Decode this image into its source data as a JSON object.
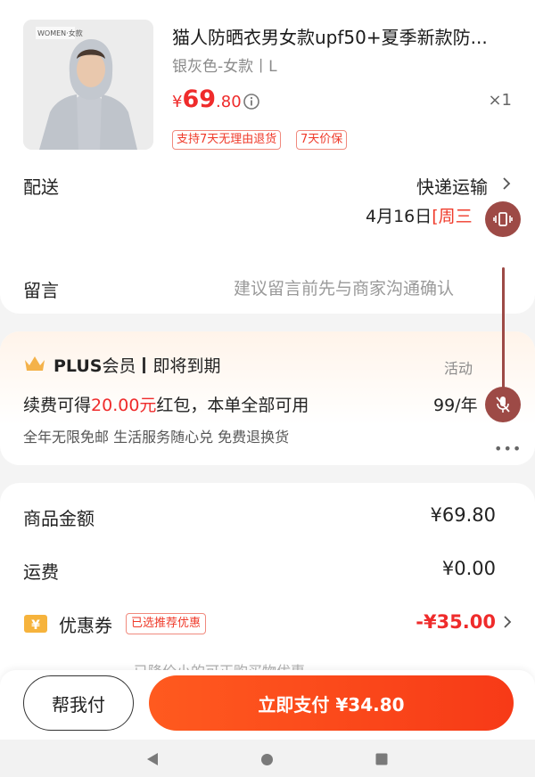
{
  "product": {
    "title": "猫人防晒衣男女款upf50+夏季新款防...",
    "thumb_label": "WOMEN·女款",
    "spec": "银灰色-女款丨L",
    "price_currency": "¥",
    "price_int": "69",
    "price_dec": ".80",
    "quantity": "×1",
    "tags": [
      "支持7天无理由退货",
      "7天价保"
    ]
  },
  "delivery": {
    "label": "配送",
    "method": "快递运输",
    "date": "4月16日",
    "weekday": "[周三"
  },
  "note": {
    "label": "留言",
    "placeholder": "建议留言前先与商家沟通确认"
  },
  "plus": {
    "brand": "PLUS",
    "member": "会员",
    "status": "即将到期",
    "activity": "活动",
    "line_prefix": "续费可得",
    "line_amount": "20.00元",
    "line_suffix": "红包，本单全部可用",
    "price": "99/年",
    "benefits": "全年无限免邮 生活服务随心兑 免费退换货"
  },
  "amounts": {
    "goods_label": "商品金额",
    "goods_value": "¥69.80",
    "shipping_label": "运费",
    "shipping_value": "¥0.00",
    "coupon_label": "优惠券",
    "coupon_badge": "已选推荐优惠",
    "coupon_value": "-¥35.00",
    "cut_text": "已降价小的可正购买物优惠"
  },
  "actions": {
    "help_pay": "帮我付",
    "pay_now": "立即支付 ¥34.80"
  },
  "colors": {
    "accent_red": "#ef2b2b",
    "pay_gradient_start": "#ff5a1f",
    "pay_gradient_end": "#f73a17",
    "float_button": "#9d4a46"
  },
  "icons": {
    "info": "info-icon",
    "chevron": "chevron-right-icon",
    "crown": "crown-icon",
    "coupon": "coupon-yen-icon",
    "vibrate": "vibrate-icon",
    "mic_off": "mic-off-icon",
    "more": "more-dots-icon",
    "nav_back": "nav-back-icon",
    "nav_home": "nav-home-icon",
    "nav_recent": "nav-recent-icon"
  }
}
